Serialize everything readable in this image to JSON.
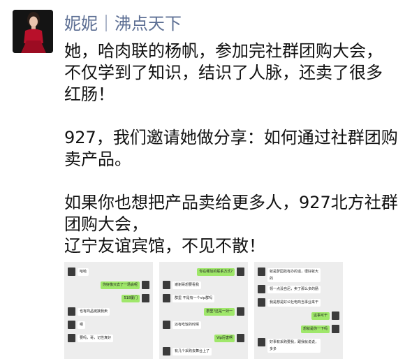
{
  "post": {
    "author": "妮妮｜沸点天下",
    "paragraphs": [
      [
        "她，哈肉联的杨帆，参加完社群团购大会，",
        "不仅学到了知识，结识了人脉，还卖了很多",
        "红肠！"
      ],
      [
        "927，我们邀请她做分享：如何通过社群团购",
        "卖产品。"
      ],
      [
        "如果你也想把产品卖给更多人，927北方社群",
        "团购大会，",
        "辽宁友谊宾馆，不见不散！"
      ]
    ]
  },
  "thumbnails": [
    {
      "messages": [
        {
          "side": "left",
          "text": "哈哈"
        },
        {
          "side": "right",
          "text": "你好像只去了一场会呢"
        },
        {
          "side": "right",
          "text": "518厦门"
        },
        {
          "side": "left",
          "text": "也有商品链接我卖"
        },
        {
          "side": "left",
          "text": "嗯"
        },
        {
          "side": "left",
          "text": "要吗，哥，记性真好"
        }
      ]
    },
    {
      "messages": [
        {
          "side": "right",
          "text": "你在哪加的联系方式?"
        },
        {
          "side": "left",
          "text": "谢谢哥想要看我"
        },
        {
          "side": "left",
          "text": "群里 不是有一个vip群吗"
        },
        {
          "side": "right",
          "text": "群里?还是一对一"
        },
        {
          "side": "left",
          "text": "还有吃饭的时候"
        },
        {
          "side": "right",
          "text": "Vip厉害啊"
        },
        {
          "side": "left",
          "text": "有几个采购去舞台上了"
        }
      ]
    },
    {
      "messages": [
        {
          "side": "left",
          "text": "就是梦园找有办的话，很好就大的",
          "two": true
        },
        {
          "side": "left",
          "text": "领一点没自尼，卖了那么多的肠"
        },
        {
          "side": "left",
          "text": "我是想是好公社电商当事业来干"
        },
        {
          "side": "right",
          "text": "这事可干"
        },
        {
          "side": "right",
          "text": "想就是你一下吗"
        },
        {
          "side": "left",
          "text": "好事有采购要我，跟我就说说，多多",
          "two": true
        }
      ]
    }
  ]
}
